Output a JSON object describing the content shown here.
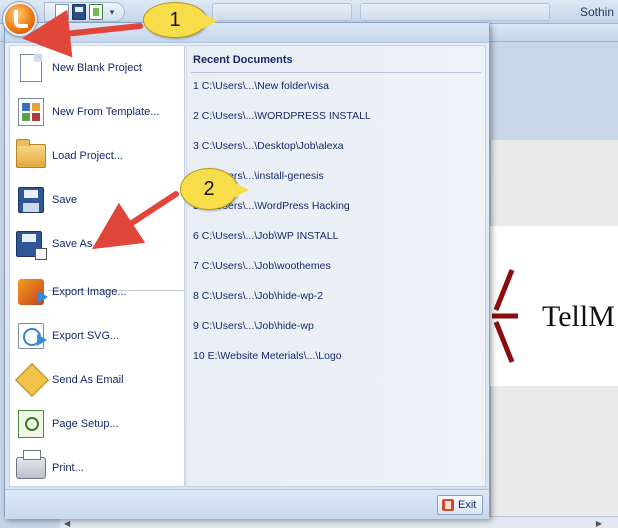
{
  "title_bar": {
    "title_fragment": "Sothin",
    "quick_access": [
      "new-document-icon",
      "save-icon",
      "template-icon",
      "customize-dropdown-icon"
    ]
  },
  "canvas": {
    "logo_text": "TellM"
  },
  "app_menu": {
    "items": [
      {
        "label": "New Blank Project",
        "icon": "new-document-icon"
      },
      {
        "label": "New From Template...",
        "icon": "template-icon"
      },
      {
        "label": "Load Project...",
        "icon": "folder-icon"
      },
      {
        "label": "Save",
        "icon": "save-icon"
      },
      {
        "label": "Save As...",
        "icon": "save-as-icon"
      },
      {
        "label": "Export Image...",
        "icon": "export-image-icon"
      },
      {
        "label": "Export SVG...",
        "icon": "export-svg-icon"
      },
      {
        "label": "Send As Email",
        "icon": "email-icon"
      },
      {
        "label": "Page Setup...",
        "icon": "page-setup-icon"
      },
      {
        "label": "Print...",
        "icon": "printer-icon"
      }
    ],
    "recent": {
      "title": "Recent Documents",
      "items": [
        "1 C:\\Users\\...\\New folder\\visa",
        "2 C:\\Users\\...\\WORDPRESS INSTALL",
        "3 C:\\Users\\...\\Desktop\\Job\\alexa",
        "4 C:\\Users\\...\\install-genesis",
        "5 C:\\Users\\...\\WordPress Hacking",
        "6 C:\\Users\\...\\Job\\WP INSTALL",
        "7 C:\\Users\\...\\Job\\woothemes",
        "8 C:\\Users\\...\\Job\\hide-wp-2",
        "9 C:\\Users\\...\\Job\\hide-wp",
        "10 E:\\Website Meterials\\...\\Logo"
      ]
    },
    "exit_label": "Exit"
  },
  "annotations": {
    "step1": "1",
    "step2": "2",
    "arrow_color": "#e0463a",
    "bubble_color": "#f7dd4a"
  }
}
